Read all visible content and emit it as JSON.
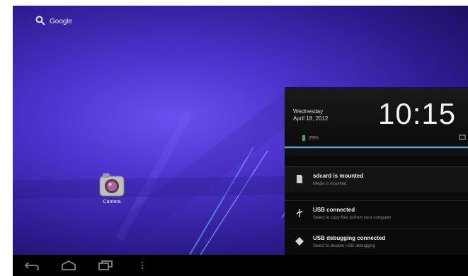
{
  "search": {
    "label": "Google"
  },
  "desktop": {
    "apps": [
      {
        "label": "Camera",
        "icon": "camera-icon"
      }
    ]
  },
  "notification_panel": {
    "day": "Wednesday",
    "date": "April 18, 2012",
    "time": "10:15",
    "battery_text": "29%",
    "items": [
      {
        "title": "sdcard is mounted",
        "subtitle": "Media is mounted",
        "icon": "sd-card-icon"
      },
      {
        "title": "USB connected",
        "subtitle": "Select to copy files to/from your computer",
        "icon": "usb-icon"
      },
      {
        "title": "USB debugging connected",
        "subtitle": "Select to disable USB debugging",
        "icon": "android-debug-icon"
      }
    ],
    "accent_color": "#33b5e5"
  },
  "navbar": {
    "buttons": [
      "back-icon",
      "home-icon",
      "recent-apps-icon",
      "menu-icon"
    ]
  }
}
